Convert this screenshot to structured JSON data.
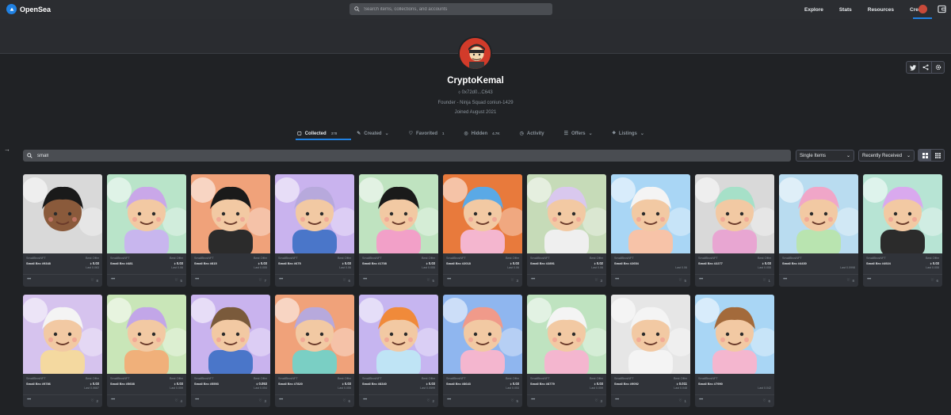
{
  "nav": {
    "brand": "OpenSea",
    "search_placeholder": "Search items, collections, and accounts",
    "links": [
      "Explore",
      "Stats",
      "Resources",
      "Create"
    ]
  },
  "profile": {
    "name": "CryptoKemal",
    "address": "0x72d0...C643",
    "bio": "Founder - Ninja Squad coniun-1429",
    "joined": "Joined August 2021"
  },
  "tabs": [
    {
      "label": "Collected",
      "count": "378"
    },
    {
      "label": "Created",
      "count": ""
    },
    {
      "label": "Favorited",
      "count": "1"
    },
    {
      "label": "Hidden",
      "count": "4.7K"
    },
    {
      "label": "Activity",
      "count": ""
    },
    {
      "label": "Offers",
      "count": ""
    },
    {
      "label": "Listings",
      "count": ""
    }
  ],
  "filter": {
    "value": "small",
    "dropdown1": "Single Items",
    "dropdown2": "Recently Received"
  },
  "cards": [
    {
      "collection": "SmallBrosNFT",
      "name": "Small Bro #9348",
      "offer_label": "Best Offer",
      "offer": "0.03",
      "last": "Last 0.063",
      "favs": "8",
      "bg": "#d9d9d9",
      "skin": "#8a5a3b",
      "hair": "#1a1a1a",
      "shirt": "#d9d9d9"
    },
    {
      "collection": "SmallBrosNFT",
      "name": "Small Bro #481",
      "offer_label": "Best Offer",
      "offer": "0.03",
      "last": "Last 0.06",
      "favs": "5",
      "bg": "#b9e4c9",
      "skin": "#f2c9a3",
      "hair": "#c9a7e8",
      "shirt": "#c8b6ee"
    },
    {
      "collection": "SmallBrosNFT",
      "name": "Small Bro #815",
      "offer_label": "Best Offer",
      "offer": "0.03",
      "last": "Last 0.055",
      "favs": "7",
      "bg": "#f0a27a",
      "skin": "#f2c9a3",
      "hair": "#1a1a1a",
      "shirt": "#2b2b2b"
    },
    {
      "collection": "SmallBrosNFT",
      "name": "Small Bro #675",
      "offer_label": "Best Offer",
      "offer": "0.03",
      "last": "Last 0.06",
      "favs": "6",
      "bg": "#c9b3ee",
      "skin": "#f2c9a3",
      "hair": "#b7a9dc",
      "shirt": "#4a76c9"
    },
    {
      "collection": "SmallBrosNFT",
      "name": "Small Bro #1708",
      "offer_label": "Best Offer",
      "offer": "0.03",
      "last": "Last 0.055",
      "favs": "5",
      "bg": "#bfe3c0",
      "skin": "#f2c9a3",
      "hair": "#1a1a1a",
      "shirt": "#f2a0c8"
    },
    {
      "collection": "SmallBrosNFT",
      "name": "Small Bro #2018",
      "offer_label": "Best Offer",
      "offer": "0.03",
      "last": "Last 0.06",
      "favs": "3",
      "bg": "#e87a3c",
      "skin": "#f2c9a3",
      "hair": "#5aa9e6",
      "shirt": "#f4b6cf"
    },
    {
      "collection": "SmallBrosNFT",
      "name": "Small Bro #2891",
      "offer_label": "Best Offer",
      "offer": "0.02",
      "last": "Last 0.06",
      "favs": "3",
      "bg": "#c6dbb8",
      "skin": "#f2c9a3",
      "hair": "#d9c8ee",
      "shirt": "#efefef"
    },
    {
      "collection": "SmallBrosNFT",
      "name": "Small Bro #2654",
      "offer_label": "",
      "offer": "",
      "last": "Last 0.06",
      "favs": "5",
      "bg": "#a9d6f5",
      "skin": "#f2c9a3",
      "hair": "#f4f4f4",
      "shirt": "#f7c3a8"
    },
    {
      "collection": "SmallBrosNFT",
      "name": "Small Bro #2277",
      "offer_label": "Best Offer",
      "offer": "0.03",
      "last": "Last 0.055",
      "favs": "1",
      "bg": "#d9d9d9",
      "skin": "#f2c9a3",
      "hair": "#a6e0c8",
      "shirt": "#e8a6d2"
    },
    {
      "collection": "SmallBrosNFT",
      "name": "Small Bro #4430",
      "offer_label": "",
      "offer": "",
      "last": "Last 0.0998",
      "favs": "8",
      "bg": "#b9dcf0",
      "skin": "#f2c9a3",
      "hair": "#f0a6c8",
      "shirt": "#b9e4b0"
    },
    {
      "collection": "SmallBrosNFT",
      "name": "Small Bro #4924",
      "offer_label": "Best Offer",
      "offer": "0.03",
      "last": "Last 0.055",
      "favs": "6",
      "bg": "#b7e4d4",
      "skin": "#f2c9a3",
      "hair": "#d9a9ee",
      "shirt": "#2b2b2b"
    },
    {
      "collection": "SmallBrosNFT",
      "name": "Small Bro #9786",
      "offer_label": "Best Offer",
      "offer": "0.03",
      "last": "Last 0.0687",
      "favs": "2",
      "bg": "#d6c3ee",
      "skin": "#f2c9a3",
      "hair": "#f4f4f4",
      "shirt": "#f4d9a0"
    },
    {
      "collection": "SmallBrosNFT",
      "name": "Small Bro #5608",
      "offer_label": "Best Offer",
      "offer": "0.03",
      "last": "Last 0.059",
      "favs": "4",
      "bg": "#c9e6b8",
      "skin": "#f2c9a3",
      "hair": "#c2a6e8",
      "shirt": "#f0b07a"
    },
    {
      "collection": "SmallBrosNFT",
      "name": "Small Bro #5593",
      "offer_label": "Best Offer",
      "offer": "0.053",
      "last": "Last 0.054",
      "favs": "3",
      "bg": "#c9b3ee",
      "skin": "#f2c9a3",
      "hair": "#7a5a3b",
      "shirt": "#4a76c9"
    },
    {
      "collection": "SmallBrosNFT",
      "name": "Small Bro #7820",
      "offer_label": "Best Offer",
      "offer": "0.03",
      "last": "Last 0.055",
      "favs": "6",
      "bg": "#f0a27a",
      "skin": "#f2c9a3",
      "hair": "#b7a9dc",
      "shirt": "#7acfc4"
    },
    {
      "collection": "SmallBrosNFT",
      "name": "Small Bro #8340",
      "offer_label": "Best Offer",
      "offer": "0.03",
      "last": "Last 0.0599",
      "favs": "2",
      "bg": "#c6b5f0",
      "skin": "#f2c9a3",
      "hair": "#f08a3a",
      "shirt": "#bfe4f5"
    },
    {
      "collection": "SmallBrosNFT",
      "name": "Small Bro #8643",
      "offer_label": "Best Offer",
      "offer": "0.03",
      "last": "Last 0.053",
      "favs": "5",
      "bg": "#8fb6ef",
      "skin": "#f2c9a3",
      "hair": "#f09a8a",
      "shirt": "#f4b6cf"
    },
    {
      "collection": "SmallBrosNFT",
      "name": "Small Bro #8779",
      "offer_label": "Best Offer",
      "offer": "0.03",
      "last": "Last 0.059",
      "favs": "3",
      "bg": "#bfe3c0",
      "skin": "#f2c9a3",
      "hair": "#f4f4f4",
      "shirt": "#f4b6cf"
    },
    {
      "collection": "SmallBrosNFT",
      "name": "Small Bro #9092",
      "offer_label": "Best Offer",
      "offer": "0.011",
      "last": "Last 0.048",
      "favs": "1",
      "bg": "#e6e6e6",
      "skin": "#f2c9a3",
      "hair": "#f4f4f4",
      "shirt": "#f4f4f4"
    },
    {
      "collection": "SmallBrosNFT",
      "name": "Small Bro #7990",
      "offer_label": "",
      "offer": "",
      "last": "Last 0.042",
      "favs": "6",
      "bg": "#a9d6f5",
      "skin": "#f2c9a3",
      "hair": "#a36a3b",
      "shirt": "#f4b6cf"
    }
  ]
}
